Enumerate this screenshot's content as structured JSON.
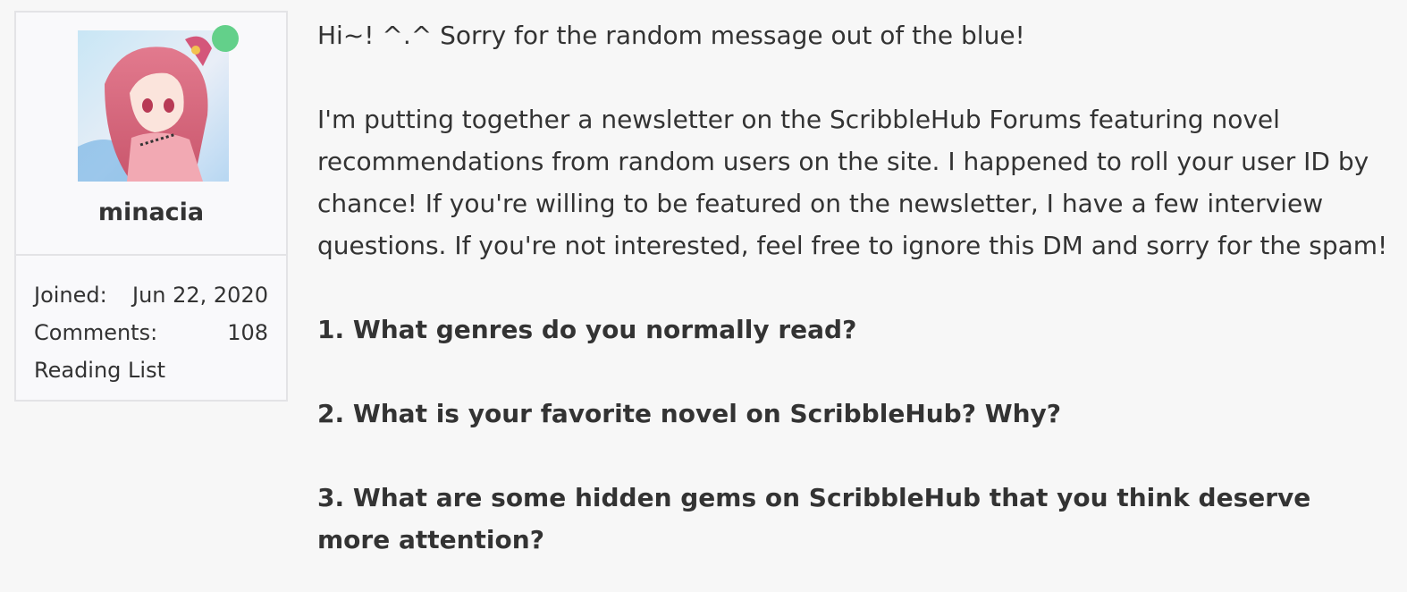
{
  "user": {
    "username": "minacia",
    "online_status_color": "#63d08a",
    "avatar_alt": "avatar",
    "stats": [
      {
        "label": "Joined:",
        "value": "Jun 22, 2020"
      },
      {
        "label": "Comments:",
        "value": "108"
      }
    ],
    "reading_list_label": "Reading List"
  },
  "message": {
    "greeting": "Hi~! ^.^ Sorry for the random message out of the blue!",
    "intro": "I'm putting together a newsletter on the ScribbleHub Forums featuring novel recommendations from random users on the site. I happened to roll your user ID by chance! If you're willing to be featured on the newsletter, I have a few interview questions. If you're not interested, feel free to ignore this DM and sorry for the spam!",
    "questions": [
      "1. What genres do you normally read?",
      "2. What is your favorite novel on ScribbleHub? Why?",
      "3. What are some hidden gems on ScribbleHub that you think deserve more attention?"
    ]
  }
}
